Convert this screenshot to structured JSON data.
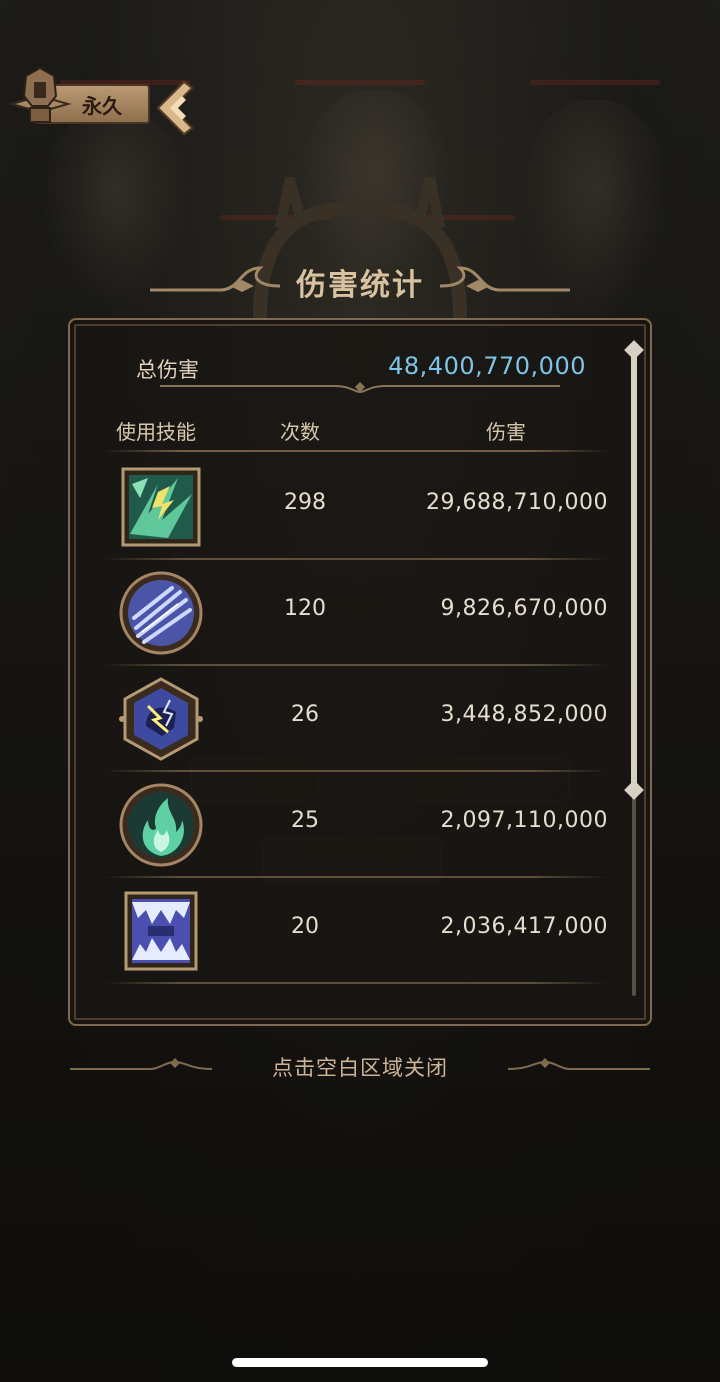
{
  "badge": {
    "label": "永久",
    "emblem_icon": "helmet-emblem-icon",
    "expand_icon": "chevron-left-icon"
  },
  "title": "伤害统计",
  "summary": {
    "total_label": "总伤害",
    "total_value": "48,400,770,000"
  },
  "table": {
    "headers": {
      "skill": "使用技能",
      "count": "次数",
      "damage": "伤害"
    },
    "rows": [
      {
        "icon": "green-slash-skill-icon",
        "frame": "square",
        "count": "298",
        "damage": "29,688,710,000"
      },
      {
        "icon": "blue-claw-skill-icon",
        "frame": "circle",
        "count": "120",
        "damage": "9,826,670,000"
      },
      {
        "icon": "lightning-fist-skill-icon",
        "frame": "hexagon",
        "count": "26",
        "damage": "3,448,852,000"
      },
      {
        "icon": "green-flame-skill-icon",
        "frame": "circle",
        "count": "25",
        "damage": "2,097,110,000"
      },
      {
        "icon": "ice-fang-skill-icon",
        "frame": "square",
        "count": "20",
        "damage": "2,036,417,000"
      }
    ]
  },
  "close_hint": "点击空白区域关闭",
  "colors": {
    "accent_gold": "#d9c2a0",
    "total_value": "#7ec4e6",
    "panel_border": "#7d6a52"
  }
}
